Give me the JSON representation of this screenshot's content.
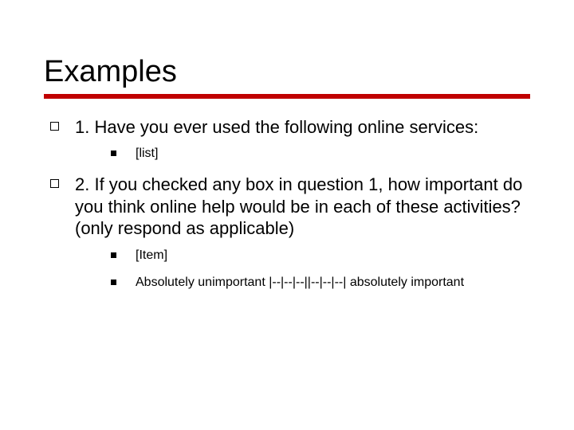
{
  "title": "Examples",
  "items": [
    {
      "text": "1. Have you ever used the following online services:",
      "sub": [
        {
          "text": "[list]"
        }
      ]
    },
    {
      "text": "2. If you checked any box in question 1, how important do you think online help would be in each of these activities? (only respond as applicable)",
      "sub": [
        {
          "text": "[Item]"
        },
        {
          "text": "Absolutely unimportant |--|--|--||--|--|--| absolutely important"
        }
      ]
    }
  ]
}
